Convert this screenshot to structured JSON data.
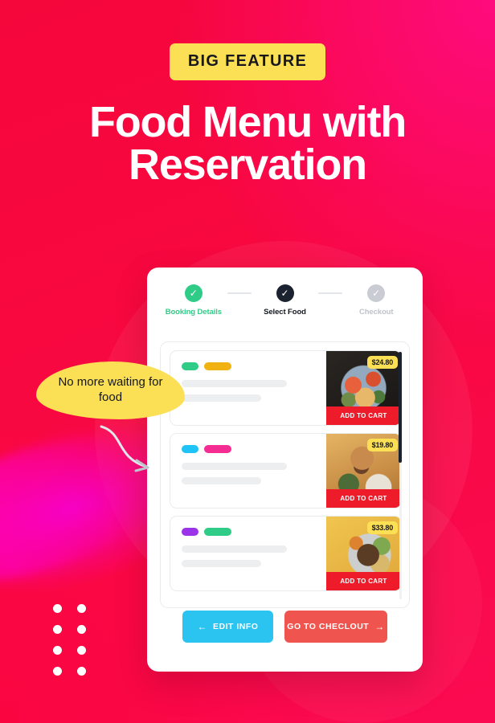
{
  "hero": {
    "badge_label": "BIG FEATURE",
    "headline_line1": "Food Menu with",
    "headline_line2": "Reservation"
  },
  "callout": {
    "text": "No more waiting for food",
    "arrow_icon": "curved-arrow-icon",
    "bg_color": "#FBDF55"
  },
  "decor": {
    "dot_grid_name": "dot-grid-decoration",
    "dot_count": 8,
    "bg_color_start": "#F5063B",
    "bg_color_end": "#FF0B7E"
  },
  "app": {
    "stepper": {
      "steps": [
        {
          "label": "Booking Details",
          "state": "done",
          "icon": "check-icon",
          "color": "#2ECC86"
        },
        {
          "label": "Select Food",
          "state": "current",
          "icon": "check-icon",
          "color": "#1C2330"
        },
        {
          "label": "Checkout",
          "state": "todo",
          "icon": "check-icon",
          "color": "#C9CCD2"
        }
      ]
    },
    "food_items": [
      {
        "price": "$24.80",
        "add_label": "ADD TO CART",
        "tag1_color": "#2ECC86",
        "tag2_color": "#EFB211",
        "dish_class": "dish1"
      },
      {
        "price": "$19.80",
        "add_label": "ADD TO CART",
        "tag1_color": "#1FC3F5",
        "tag2_color": "#F52D93",
        "dish_class": "dish2"
      },
      {
        "price": "$33.80",
        "add_label": "ADD TO CART",
        "tag1_color": "#9B34E8",
        "tag2_color": "#2ECC86",
        "dish_class": "dish3"
      }
    ],
    "actions": {
      "edit_label": "EDIT INFO",
      "edit_arrow": "←",
      "edit_color": "#2BC3F0",
      "checkout_label": "GO TO CHECLOUT",
      "checkout_arrow": "→",
      "checkout_color": "#F0544F"
    }
  }
}
